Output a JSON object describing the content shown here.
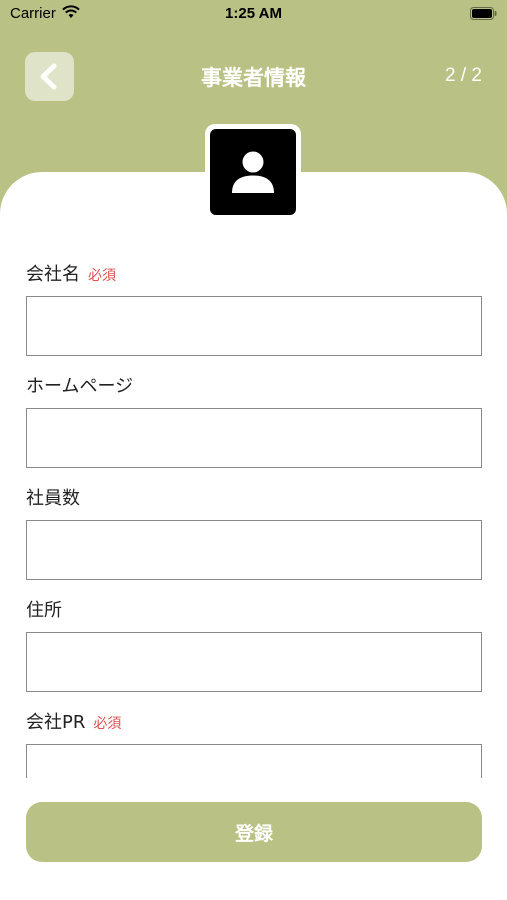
{
  "status_bar": {
    "carrier": "Carrier",
    "time": "1:25 AM",
    "wifi_icon": "wifi-icon",
    "battery_icon": "battery-icon"
  },
  "nav": {
    "back_icon": "chevron-left-icon",
    "title": "事業者情報",
    "page_indicator": "2 / 2"
  },
  "avatar": {
    "icon": "user-icon"
  },
  "form": {
    "fields": [
      {
        "label": "会社名",
        "required_label": "必須",
        "value": "",
        "placeholder": ""
      },
      {
        "label": "ホームページ",
        "required_label": "",
        "value": "",
        "placeholder": ""
      },
      {
        "label": "社員数",
        "required_label": "",
        "value": "",
        "placeholder": ""
      },
      {
        "label": "住所",
        "required_label": "",
        "value": "",
        "placeholder": ""
      },
      {
        "label": "会社PR",
        "required_label": "必須",
        "value": "",
        "placeholder": ""
      }
    ]
  },
  "submit_label": "登録",
  "colors": {
    "accent": "#b9c184",
    "required": "#e05050",
    "input_border": "#8a8a8a"
  }
}
